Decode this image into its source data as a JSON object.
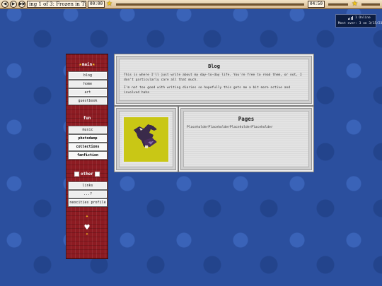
{
  "player": {
    "marquee": "ing 1 of 3: Frozen in Tim",
    "time": "00:00",
    "time_end": "04:50",
    "prev_icon": "prev-icon",
    "play_icon": "play-icon",
    "next_icon": "next-icon"
  },
  "online": {
    "count": "1 Online",
    "most": "Most ever: 3 on 3/15/23"
  },
  "sidebar": {
    "main_heading": "main",
    "main_items": [
      "blog",
      "home",
      "art",
      "guestbook"
    ],
    "fun_heading": "fun",
    "fun_items": [
      "music",
      "photodump",
      "collections",
      "fanfiction"
    ],
    "other_heading": "other",
    "other_items": [
      "links",
      "...?",
      "neocities profile"
    ]
  },
  "blog": {
    "title": "Blog",
    "para1": "This is where I'll just write about my day-to-day life. You're free to read them, or not, I don't particularly care all that much.",
    "para2": "I'm not too good with writing diaries so hopefully this gets me a bit more active and involved haha"
  },
  "pages": {
    "title": "Pages",
    "body": "PlaceholderPlaceholderPlaceholderPlaceholder"
  },
  "colors": {
    "background": "#2b4f9e",
    "sidebar": "#8d1b22",
    "pixel_art_bg": "#c9c715",
    "star": "#f2c418"
  }
}
